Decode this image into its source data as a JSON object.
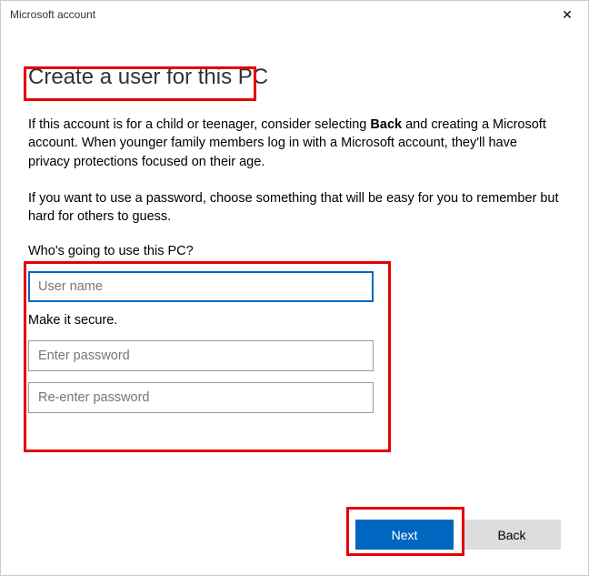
{
  "window": {
    "title": "Microsoft account"
  },
  "page": {
    "heading": "Create a user for this PC",
    "description1_pre": "If this account is for a child or teenager, consider selecting ",
    "description1_bold": "Back",
    "description1_post": " and creating a Microsoft account. When younger family members log in with a Microsoft account, they'll have privacy protections focused on their age.",
    "description2": "If you want to use a password, choose something that will be easy for you to remember but hard for others to guess."
  },
  "form": {
    "who_label": "Who's going to use this PC?",
    "username_placeholder": "User name",
    "username_value": "",
    "secure_label": "Make it secure.",
    "password_placeholder": "Enter password",
    "password_value": "",
    "repassword_placeholder": "Re-enter password",
    "repassword_value": ""
  },
  "buttons": {
    "next": "Next",
    "back": "Back"
  }
}
